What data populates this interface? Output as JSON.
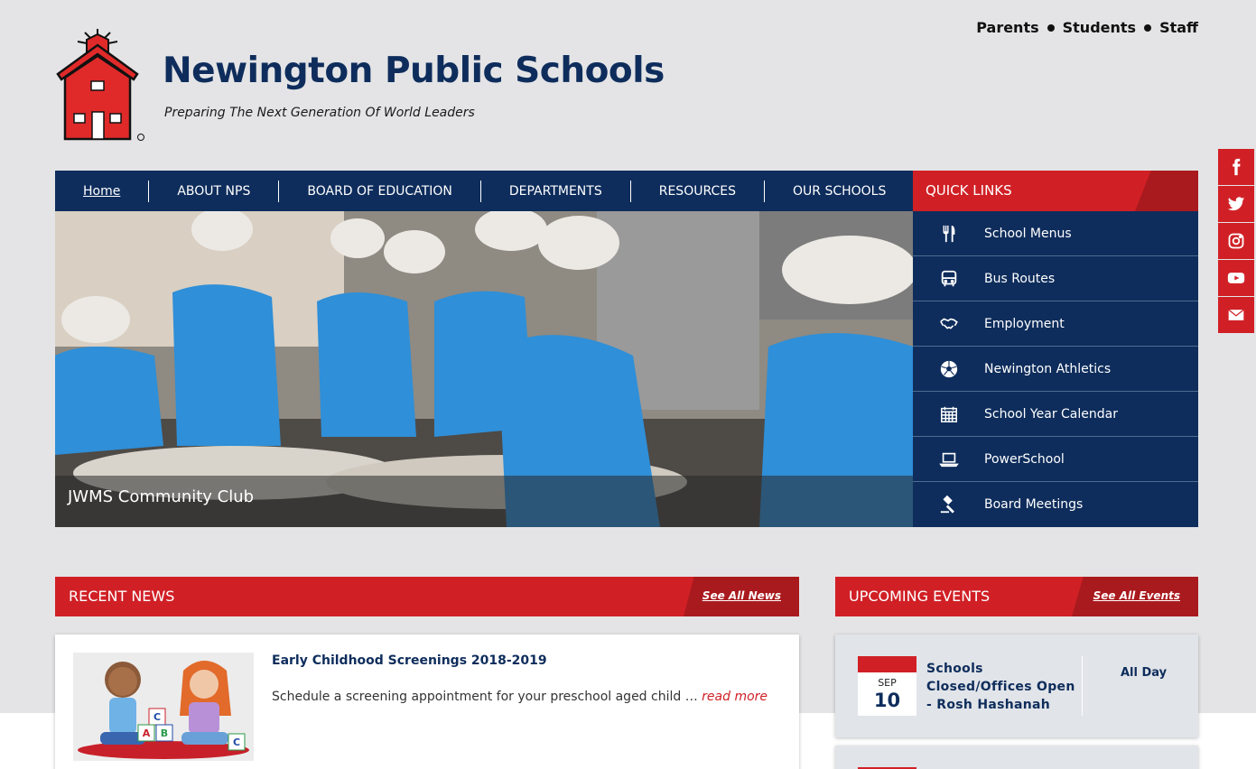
{
  "header": {
    "title": "Newington Public Schools",
    "tagline": "Preparing The Next Generation Of World Leaders",
    "audience_links": [
      "Parents",
      "Students",
      "Staff"
    ]
  },
  "nav": {
    "items": [
      "Home",
      "ABOUT NPS",
      "BOARD OF EDUCATION",
      "DEPARTMENTS",
      "RESOURCES",
      "OUR SCHOOLS"
    ]
  },
  "hero": {
    "caption": "JWMS Community Club"
  },
  "quick_links": {
    "title": "QUICK LINKS",
    "items": [
      {
        "label": "School Menus",
        "icon": "utensils-icon"
      },
      {
        "label": "Bus Routes",
        "icon": "bus-icon"
      },
      {
        "label": "Employment",
        "icon": "handshake-icon"
      },
      {
        "label": "Newington Athletics",
        "icon": "soccer-ball-icon"
      },
      {
        "label": "School Year Calendar",
        "icon": "calendar-icon"
      },
      {
        "label": "PowerSchool",
        "icon": "laptop-icon"
      },
      {
        "label": "Board Meetings",
        "icon": "gavel-icon"
      }
    ]
  },
  "social": [
    "facebook-icon",
    "twitter-icon",
    "instagram-icon",
    "youtube-icon",
    "email-icon"
  ],
  "news": {
    "title": "RECENT NEWS",
    "see_all": "See All News",
    "items": [
      {
        "title": "Early Childhood Screenings 2018-2019",
        "excerpt": "Schedule a screening appointment for your preschool aged child …",
        "read_more": "read more"
      }
    ]
  },
  "events": {
    "title": "UPCOMING EVENTS",
    "see_all": "See All Events",
    "items": [
      {
        "month": "SEP",
        "day": "10",
        "title": "Schools Closed/Offices Open - Rosh Hashanah",
        "time": "All Day"
      }
    ]
  },
  "colors": {
    "navy": "#0e2d5c",
    "red": "#d02026",
    "dark_red": "#a91a1e",
    "page_bg": "#e4e4e6"
  }
}
